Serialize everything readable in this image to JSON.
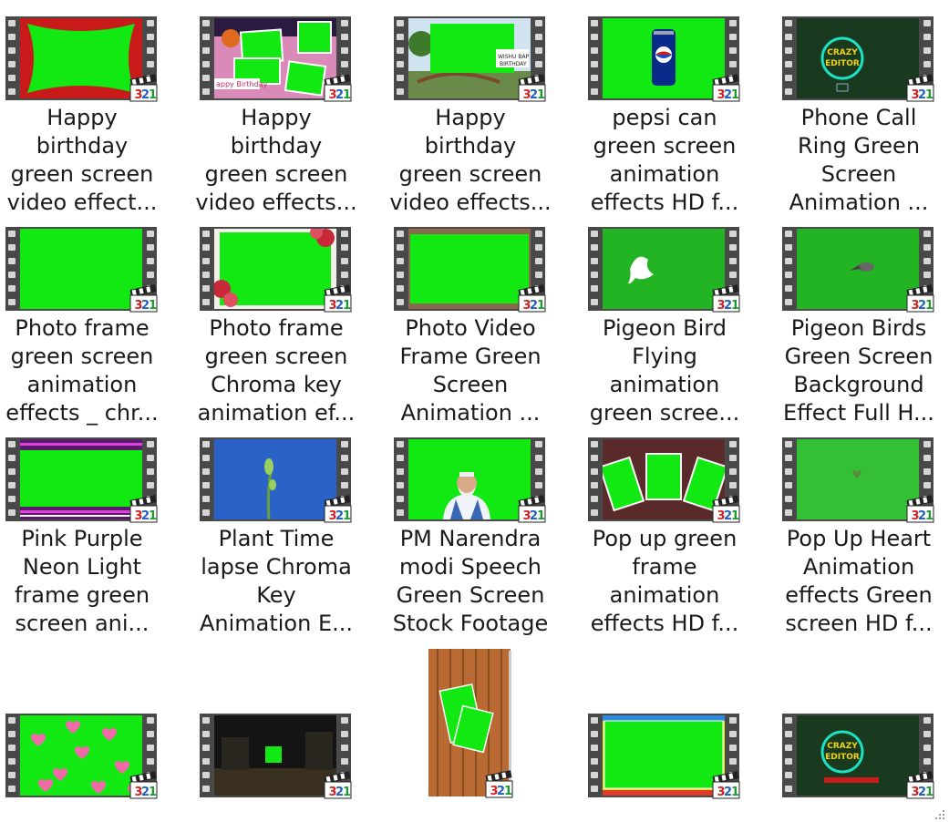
{
  "files": [
    {
      "title": [
        "Happy",
        "birthday",
        "green screen",
        "video effect..."
      ],
      "thumb": "red-swirl-frame"
    },
    {
      "title": [
        "Happy",
        "birthday",
        "green screen",
        "video effects..."
      ],
      "thumb": "collage-birthday"
    },
    {
      "title": [
        "Happy",
        "birthday",
        "green screen",
        "video effects..."
      ],
      "thumb": "bridge-scene"
    },
    {
      "title": [
        "pepsi can",
        "green screen",
        "animation",
        "effects HD f..."
      ],
      "thumb": "pepsi-can"
    },
    {
      "title": [
        "Phone Call",
        "Ring Green",
        "Screen",
        "Animation ..."
      ],
      "thumb": "crazy-editor"
    },
    {
      "title": [
        "Photo frame",
        "green screen",
        "animation",
        "effects _ chr..."
      ],
      "thumb": "plain-green"
    },
    {
      "title": [
        "Photo frame",
        "green screen",
        "Chroma key",
        "animation ef..."
      ],
      "thumb": "flower-frame"
    },
    {
      "title": [
        "Photo Video",
        "Frame Green",
        "Screen",
        "Animation ..."
      ],
      "thumb": "bordered-green"
    },
    {
      "title": [
        "Pigeon Bird",
        "Flying",
        "animation",
        "green scree..."
      ],
      "thumb": "white-dove"
    },
    {
      "title": [
        "Pigeon Birds",
        "Green Screen",
        "Background",
        "Effect Full H..."
      ],
      "thumb": "grey-pigeon"
    },
    {
      "title": [
        "Pink Purple",
        "Neon Light",
        "frame green",
        "screen ani..."
      ],
      "thumb": "neon-stripes"
    },
    {
      "title": [
        "Plant Time",
        "lapse Chroma",
        "Key",
        "Animation E..."
      ],
      "thumb": "plant-blue"
    },
    {
      "title": [
        "PM Narendra",
        "modi Speech",
        "Green Screen",
        "Stock Footage"
      ],
      "thumb": "speaker"
    },
    {
      "title": [
        "Pop up green",
        "frame",
        "animation",
        "effects HD f..."
      ],
      "thumb": "popup-frames"
    },
    {
      "title": [
        "Pop Up Heart",
        "Animation",
        "effects Green",
        "screen HD f..."
      ],
      "thumb": "small-heart"
    }
  ],
  "bottom_row": [
    {
      "thumb": "hearts"
    },
    {
      "thumb": "night-street"
    },
    {
      "thumb": "wood-portrait"
    },
    {
      "thumb": "rainbow-border"
    },
    {
      "thumb": "crazy-editor-2"
    }
  ],
  "badge_text": "321",
  "logo_text": [
    "CRAZY",
    "EDITOR"
  ],
  "colors": {
    "chroma": "#12e812",
    "film": "#484848",
    "badge_blue": "#1e5fbf",
    "badge_red": "#d42020"
  }
}
